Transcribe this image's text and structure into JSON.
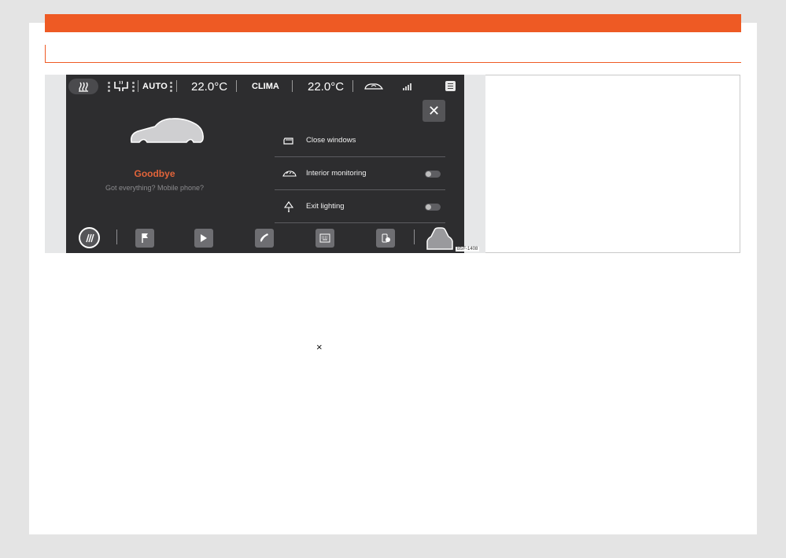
{
  "status_bar": {
    "mode": "AUTO",
    "left_temp": "22.0",
    "left_temp_unit": "°C",
    "clima": "CLIMA",
    "right_temp": "22.0",
    "right_temp_unit": "°C",
    "icons": [
      "heated-rear-window-icon",
      "seat-heating-icon",
      "recirculation-car-icon",
      "signal-icon",
      "menu-icon"
    ]
  },
  "panel": {
    "close_glyph": "✕",
    "title": "Goodbye",
    "subtitle": "Got everything? Mobile phone?",
    "options": [
      {
        "label": "Close windows",
        "icon": "window-icon",
        "has_toggle": false
      },
      {
        "label": "Interior monitoring",
        "icon": "interior-monitoring-icon",
        "has_toggle": true,
        "on": false
      },
      {
        "label": "Exit lighting",
        "icon": "exit-lighting-icon",
        "has_toggle": true,
        "on": false
      }
    ]
  },
  "dock": {
    "icons": [
      "rear-defrost-icon",
      "navigation-flag-icon",
      "media-play-icon",
      "phone-icon",
      "apps-keyboard-icon",
      "car-settings-icon",
      "car-icon"
    ]
  },
  "figure_code": "B5F-1408",
  "loose_glyph": "×",
  "colors": {
    "accent": "#ee5a24",
    "goodbye": "#e2643a",
    "screen": "#2d2d2f"
  }
}
